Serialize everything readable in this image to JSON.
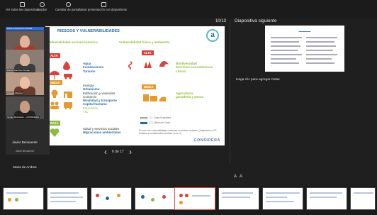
{
  "toolbar": {
    "items": [
      {
        "label": "Ver todas las diapositivas",
        "icon": "grid-icon"
      },
      {
        "label": "Ampliar"
      },
      {
        "label": "Cambiar de pantalla"
      },
      {
        "label": "Usar presentación con diapositivas"
      }
    ]
  },
  "presenter": {
    "slide_counter": "10/13",
    "next_label": "Diapositiva siguiente",
    "notes_placeholder": "Haga clic para agregar notas",
    "nav_text": "6 de 17"
  },
  "slide": {
    "title": "RIESGOS Y VULNERABILIDADES",
    "left_header": "Vulnerabilidad socioeconómica:",
    "right_header": "Vulnerabilidad física y ambiental",
    "levels": {
      "alta": "ALTA",
      "media": "MEDIA",
      "baja": "BAJA"
    },
    "alta_left": [
      "Agua",
      "Inundaciones",
      "Turismo"
    ],
    "alta_right": [
      "Biodiversidad",
      "Servicios ecosistémicos",
      "Litoral"
    ],
    "media_left": [
      "Energía",
      "Urbanismo",
      "Edificación y viviendas",
      "Comercio",
      "Movilidad y transporte",
      "Capital humano",
      "Educación",
      "TIC"
    ],
    "media_right": [
      "Agricultura,",
      "ganadería y pesca"
    ],
    "baja_left": [
      "Salud y servicios sociales",
      "Migraciones ambientales"
    ],
    "legend": [
      "C.I. Costa Granadina",
      "C.C. Bahía de Cádiz"
    ],
    "note": "En azul, las vulnerabilidades comunes en ambas ciudades. (Adaptación a TG Andaluz a consideración de Aban en su o)",
    "brand": "CONSIDERA"
  },
  "participants": {
    "banner": "Estás compartiendo pantalla",
    "tiles": [
      "Tere Guzmán Ruiz",
      "Daniel Sanchez Amagil",
      "Claudia Marquez",
      "Sergio Rebolledo - CONSIDERA"
    ],
    "list": [
      "Javier Benavente",
      "Javier Benavente",
      "Maria de Andres"
    ]
  },
  "colors": {
    "accent": "#1e6aa8",
    "alta": "#d7443a",
    "media": "#e49a2e",
    "baja": "#8bbb3d"
  },
  "filmstrip_active": 5
}
